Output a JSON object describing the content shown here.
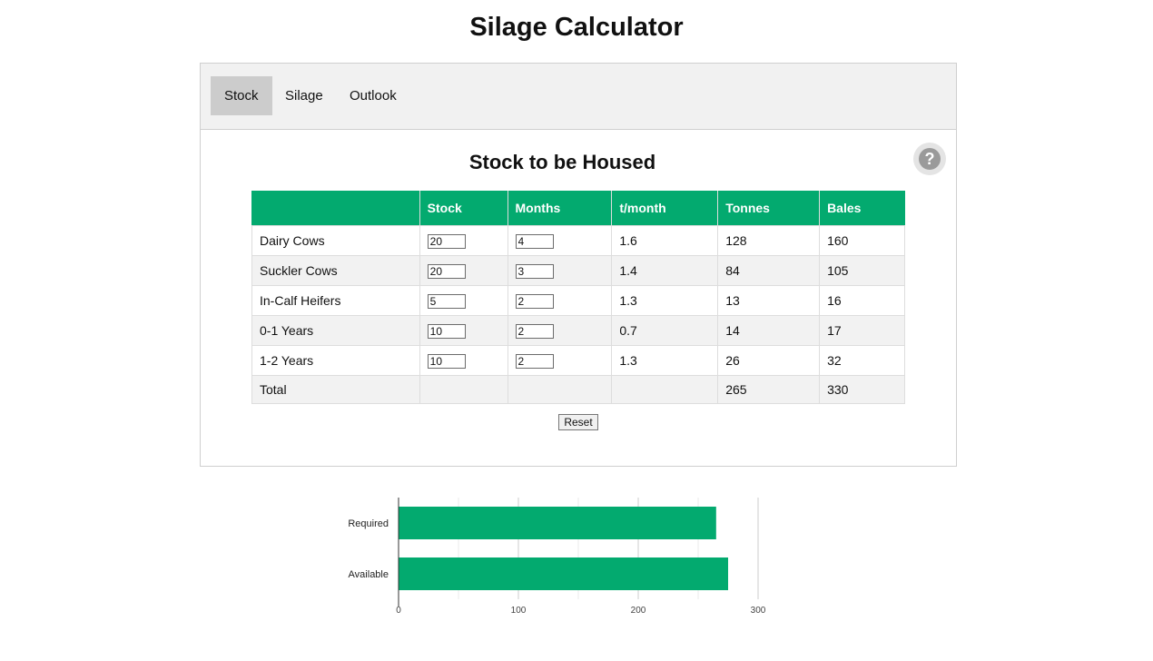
{
  "app": {
    "title": "Silage Calculator"
  },
  "tabs": [
    {
      "label": "Stock",
      "active": true
    },
    {
      "label": "Silage",
      "active": false
    },
    {
      "label": "Outlook",
      "active": false
    }
  ],
  "stock": {
    "title": "Stock to be Housed",
    "help_icon": "question-circle-icon",
    "headers": [
      "",
      "Stock",
      "Months",
      "t/month",
      "Tonnes",
      "Bales"
    ],
    "rows": [
      {
        "label": "Dairy Cows",
        "stock": "20",
        "months": "4",
        "t_month": "1.6",
        "tonnes": "128",
        "bales": "160"
      },
      {
        "label": "Suckler Cows",
        "stock": "20",
        "months": "3",
        "t_month": "1.4",
        "tonnes": "84",
        "bales": "105"
      },
      {
        "label": "In-Calf Heifers",
        "stock": "5",
        "months": "2",
        "t_month": "1.3",
        "tonnes": "13",
        "bales": "16"
      },
      {
        "label": "0-1 Years",
        "stock": "10",
        "months": "2",
        "t_month": "0.7",
        "tonnes": "14",
        "bales": "17"
      },
      {
        "label": "1-2 Years",
        "stock": "10",
        "months": "2",
        "t_month": "1.3",
        "tonnes": "26",
        "bales": "32"
      }
    ],
    "total": {
      "label": "Total",
      "tonnes": "265",
      "bales": "330"
    },
    "reset_label": "Reset"
  },
  "colors": {
    "accent": "#03aa6f",
    "tab_bg": "#f1f1f1",
    "tab_active": "#cccccc"
  },
  "chart_data": {
    "type": "bar",
    "orientation": "horizontal",
    "categories": [
      "Required",
      "Available"
    ],
    "values": [
      265,
      275
    ],
    "xlim": [
      0,
      300
    ],
    "xticks": [
      "0",
      "100",
      "200",
      "300"
    ],
    "grid": true,
    "color": "#03aa6f"
  }
}
